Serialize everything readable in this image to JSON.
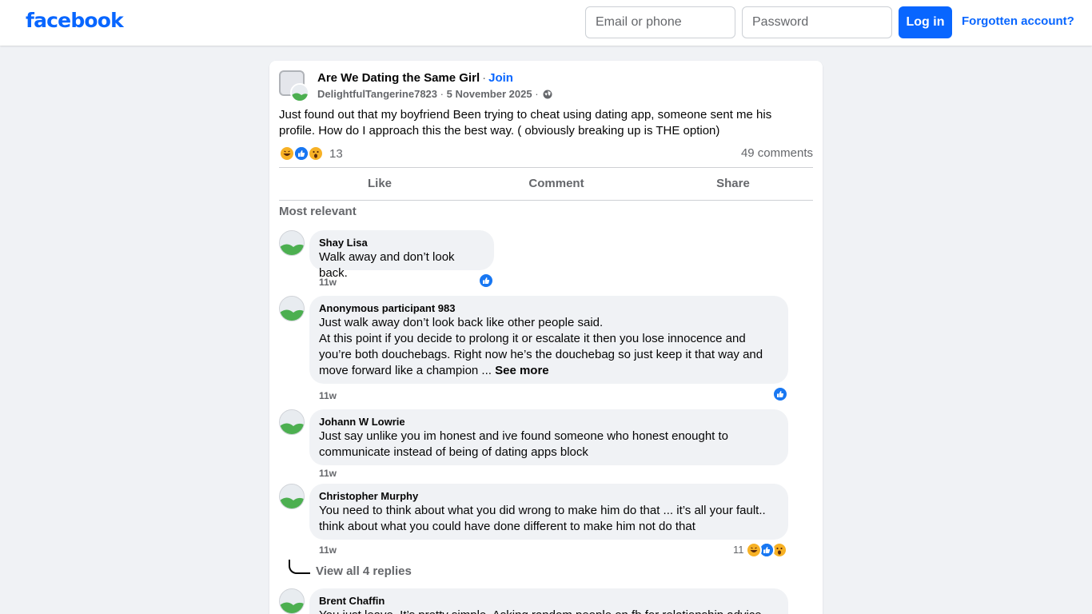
{
  "header": {
    "logo": "facebook",
    "email_placeholder": "Email or phone",
    "password_placeholder": "Password",
    "login_label": "Log in",
    "forgot_label": "Forgotten account?",
    "brand_color": "#0866ff"
  },
  "post": {
    "group_name": "Are We Dating the Same Girl",
    "separator": "·",
    "join_label": "Join",
    "author": "DelightfulTangerine7823",
    "date": "5 November 2025",
    "audience_icon": "globe-icon",
    "text": "Just found out that my boyfriend Been trying to cheat using dating app, someone sent me his profile. How do I approach this the best way. ( obviously breaking up is THE option)",
    "reactions": [
      "haha",
      "like",
      "wow"
    ],
    "reaction_count": "13",
    "comment_count": "49 comments",
    "actions": {
      "like": "Like",
      "comment": "Comment",
      "share": "Share"
    },
    "sort_label": "Most relevant"
  },
  "comments": [
    {
      "name": "Shay Lisa",
      "lines": [
        "Walk away and don’t look back."
      ],
      "time": "11w",
      "reactions": [
        "like"
      ]
    },
    {
      "name": "Anonymous participant 983",
      "lines": [
        "Just walk away don’t look back like other people said.",
        "At this point if you decide to prolong it or escalate it then you lose innocence and",
        "you’re both douchebags. Right now he’s the douchebag so just keep it that way and",
        "move forward like a champion ..."
      ],
      "see_more": "See more",
      "time": "11w",
      "reactions": [
        "like"
      ]
    },
    {
      "name": "Johann W Lowrie",
      "lines": [
        "Just say unlike you im honest and ive found someone who honest enought to",
        "communicate instead of being of dating apps block"
      ],
      "time": "11w"
    },
    {
      "name": "Christopher Murphy",
      "lines": [
        "You need to think about what you did wrong to make him do that ... it’s all your fault..",
        "think about what you could have done different to make him not do that"
      ],
      "time": "11w",
      "reaction_count": "11",
      "reactions": [
        "haha",
        "like",
        "wow"
      ],
      "replies_label": "View all 4 replies"
    },
    {
      "name": "Brent Chaffin",
      "lines": [
        "You just leave. It’s pretty simple. Asking random people on fb for relationship advice"
      ]
    }
  ]
}
